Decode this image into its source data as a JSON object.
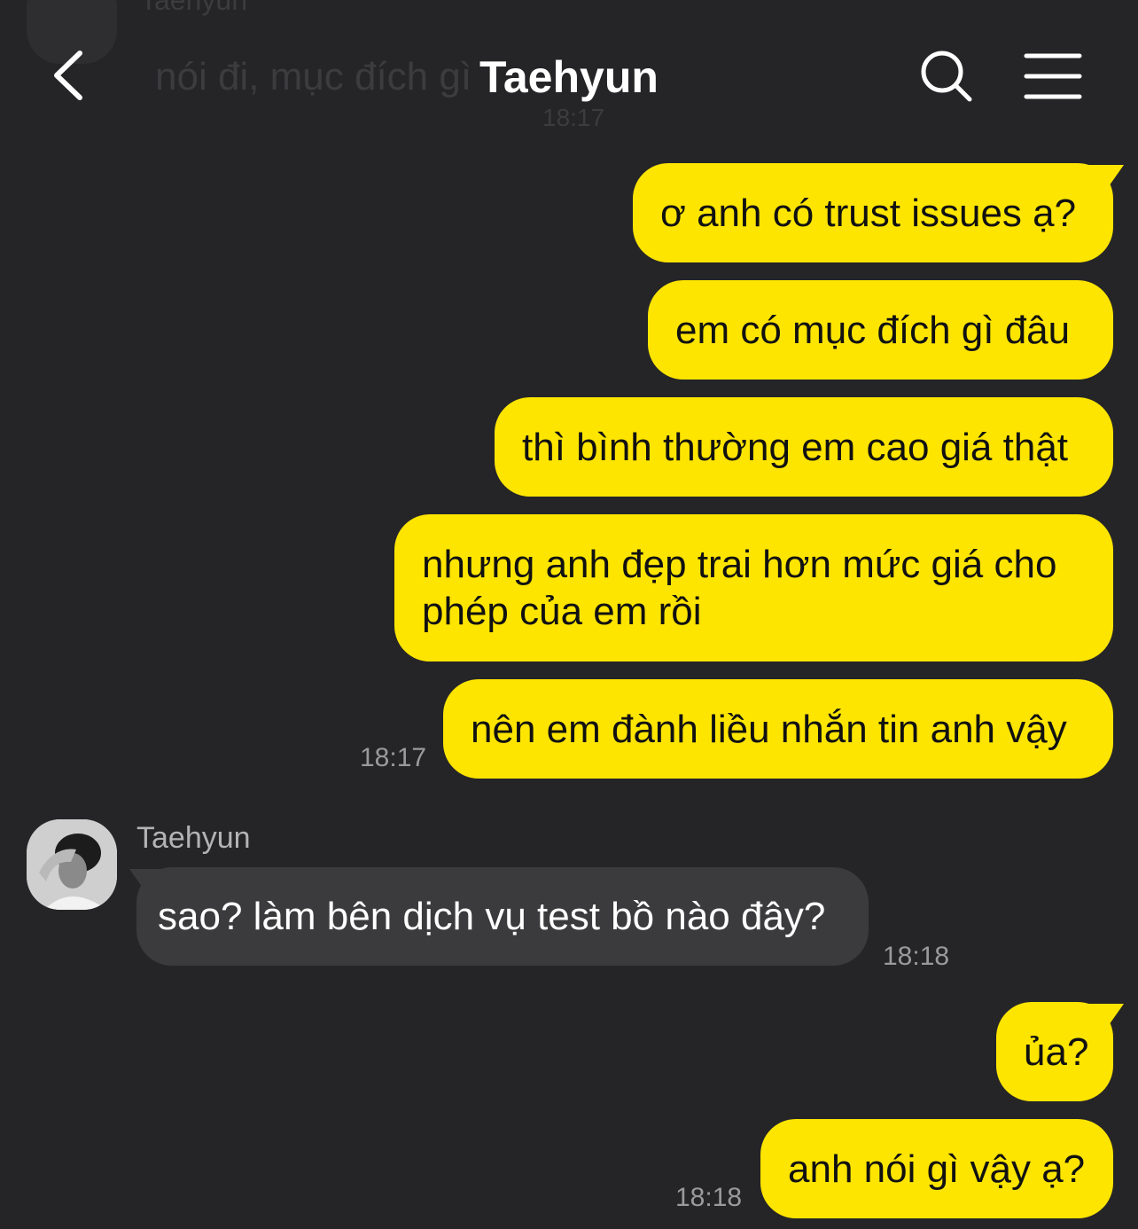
{
  "header": {
    "title": "Taehyun"
  },
  "background_preview": {
    "name": "Taehyun",
    "text": "nói đi, mục đích gì",
    "time": "18:17"
  },
  "messages": [
    {
      "direction": "out",
      "text": "ơ anh có trust issues ạ?"
    },
    {
      "direction": "out",
      "text": "em có mục đích gì đâu"
    },
    {
      "direction": "out",
      "text": "thì bình thường em cao giá thật"
    },
    {
      "direction": "out",
      "text": "nhưng anh đẹp trai hơn mức giá cho phép của em rồi"
    },
    {
      "direction": "out",
      "text": "nên em đành liều nhắn tin anh vậy",
      "time": "18:17"
    },
    {
      "direction": "in",
      "sender": "Taehyun",
      "text": "sao? làm bên dịch vụ test bồ nào đây?",
      "time": "18:18"
    },
    {
      "direction": "out",
      "text": "ủa?"
    },
    {
      "direction": "out",
      "text": "anh nói gì vậy ạ?",
      "time": "18:18"
    }
  ],
  "colors": {
    "background": "#252527",
    "outgoing_bubble": "#fee500",
    "incoming_bubble": "#3b3b3d",
    "timestamp": "#9a9a9c"
  },
  "icons": {
    "back": "chevron-left-icon",
    "search": "search-icon",
    "menu": "hamburger-menu-icon"
  }
}
